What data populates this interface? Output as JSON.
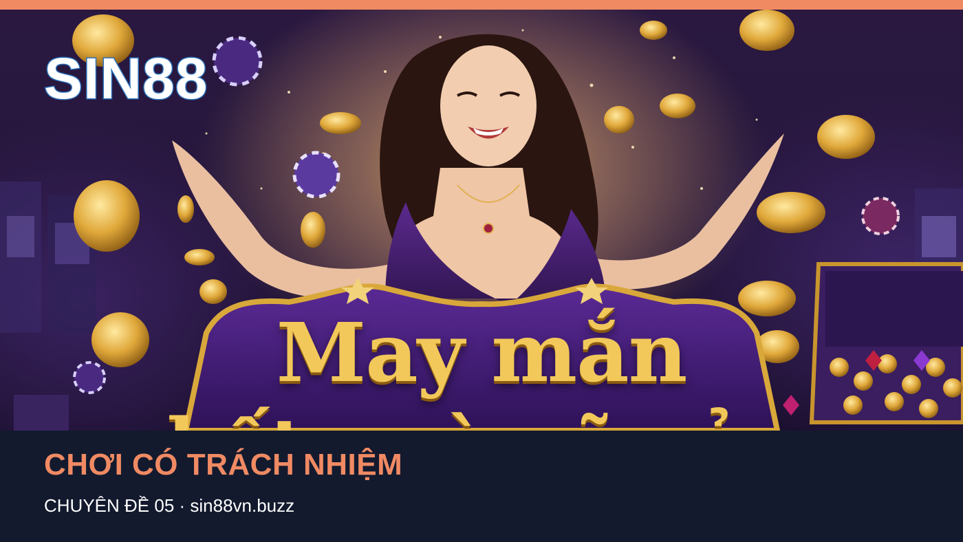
{
  "brand": {
    "logo_text": "SIN88"
  },
  "banner": {
    "headline_line1": "May mắn",
    "headline_line2": "hết ngờ gõ cửa"
  },
  "footer": {
    "title": "CHƠI CÓ TRÁCH NHIỆM",
    "subtitle": "CHUYÊN ĐỀ 05 · sin88vn.buzz"
  },
  "colors": {
    "accent": "#f08a63",
    "footer_bg": "#131a2e",
    "gold": "#f2c85a",
    "purple": "#4b2480"
  }
}
